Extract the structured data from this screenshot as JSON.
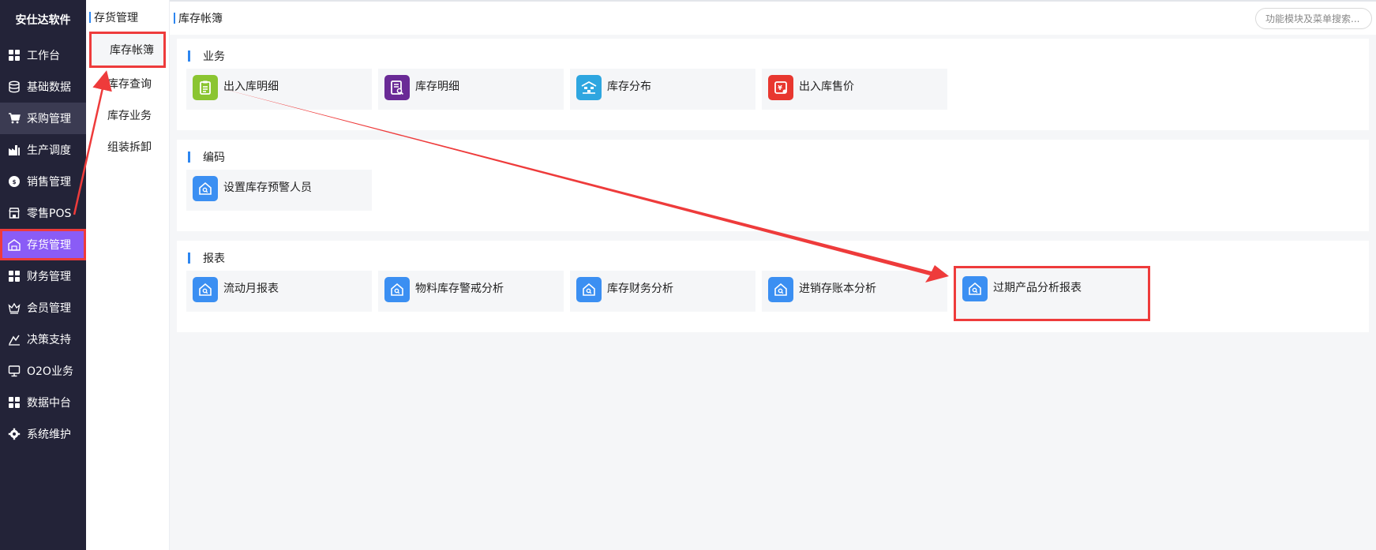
{
  "app": {
    "brand": "安仕达软件"
  },
  "sidebar": {
    "items": [
      {
        "label": "工作台",
        "icon": "grid-icon"
      },
      {
        "label": "基础数据",
        "icon": "database-icon"
      },
      {
        "label": "采购管理",
        "icon": "cart-icon"
      },
      {
        "label": "生产调度",
        "icon": "factory-icon"
      },
      {
        "label": "销售管理",
        "icon": "sales-icon"
      },
      {
        "label": "零售POS",
        "icon": "store-icon"
      },
      {
        "label": "存货管理",
        "icon": "warehouse-icon"
      },
      {
        "label": "财务管理",
        "icon": "grid-icon"
      },
      {
        "label": "会员管理",
        "icon": "crown-icon"
      },
      {
        "label": "决策支持",
        "icon": "decision-icon"
      },
      {
        "label": "O2O业务",
        "icon": "monitor-icon"
      },
      {
        "label": "数据中台",
        "icon": "grid-icon"
      },
      {
        "label": "系统维护",
        "icon": "gear-icon"
      }
    ]
  },
  "submenu": {
    "title": "存货管理",
    "items": [
      {
        "label": "库存帐簿"
      },
      {
        "label": "库存查询"
      },
      {
        "label": "库存业务"
      },
      {
        "label": "组装拆卸"
      }
    ]
  },
  "topbar": {
    "title": "库存帐簿",
    "search_placeholder": "功能模块及菜单搜索..."
  },
  "sections": [
    {
      "title": "业务",
      "cards": [
        {
          "label": "出入库明细",
          "icon": "clipboard-icon",
          "color": "#8bc531"
        },
        {
          "label": "库存明细",
          "icon": "document-search-icon",
          "color": "#6a2a96"
        },
        {
          "label": "库存分布",
          "icon": "warehouse-shelf-icon",
          "color": "#2ea6e0"
        },
        {
          "label": "出入库售价",
          "icon": "price-tag-icon",
          "color": "#e8372f"
        }
      ]
    },
    {
      "title": "编码",
      "cards": [
        {
          "label": "设置库存预警人员",
          "icon": "house-search-icon",
          "color": "#3b8ff2"
        }
      ]
    },
    {
      "title": "报表",
      "cards": [
        {
          "label": "流动月报表",
          "icon": "house-search-icon",
          "color": "#3b8ff2"
        },
        {
          "label": "物料库存警戒分析",
          "icon": "house-search-icon",
          "color": "#3b8ff2"
        },
        {
          "label": "库存财务分析",
          "icon": "house-search-icon",
          "color": "#3b8ff2"
        },
        {
          "label": "进销存账本分析",
          "icon": "house-search-icon",
          "color": "#3b8ff2"
        },
        {
          "label": "过期产品分析报表",
          "icon": "house-search-icon",
          "color": "#3b8ff2"
        }
      ]
    }
  ],
  "colors": {
    "sidebar_bg": "#232338",
    "active_nav": "#8a5cf6",
    "accent": "#2d86f0",
    "annotation": "#ee3b3b"
  }
}
